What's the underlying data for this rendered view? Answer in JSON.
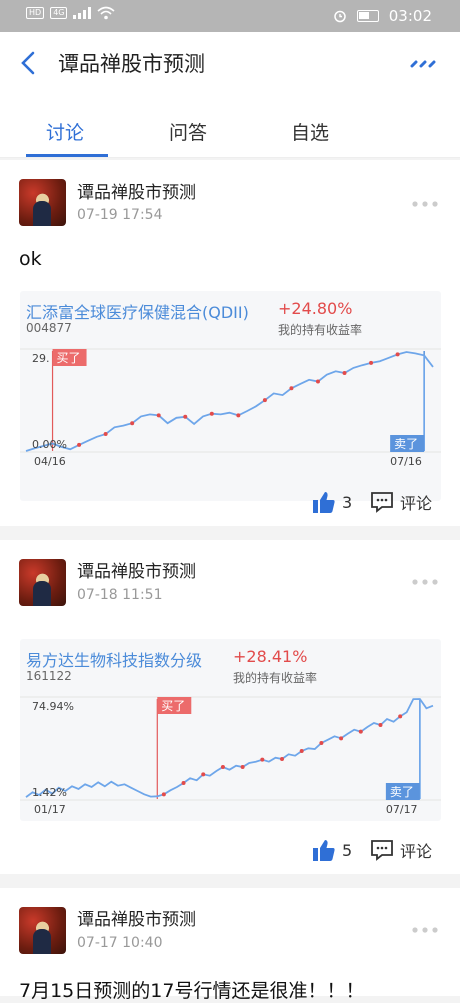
{
  "status_bar": {
    "time": "03:02",
    "signal_left": "HD",
    "signal_right": "4G"
  },
  "header": {
    "title": "谭品禅股市预测"
  },
  "tabs": [
    {
      "label": "讨论",
      "active": true
    },
    {
      "label": "问答"
    },
    {
      "label": "自选"
    }
  ],
  "posts": [
    {
      "author": "谭品禅股市预测",
      "time": "07-19 17:54",
      "text": "ok",
      "fund": {
        "name": "汇添富全球医疗保健混合(QDII)",
        "return": "+24.80%",
        "code": "004877",
        "return_label": "我的持有收益率",
        "y_top": "29.",
        "y_bottom": "0.00%",
        "buy_label": "买了",
        "sell_label": "卖了",
        "x_start": "04/16",
        "x_end": "07/16",
        "chart_data": {
          "type": "line",
          "x": [
            "04/16",
            "07/16"
          ],
          "values": [
            0.0,
            0.8,
            1.5,
            2.2,
            1.2,
            0.5,
            1.8,
            3.0,
            4.2,
            5.0,
            7.0,
            7.5,
            8.2,
            10.2,
            10.8,
            10.5,
            8.2,
            9.8,
            10.1,
            8.0,
            10.2,
            11.0,
            10.8,
            11.3,
            10.5,
            11.8,
            13.2,
            15.0,
            17.0,
            16.5,
            18.5,
            19.8,
            21.0,
            20.5,
            22.5,
            23.5,
            23.0,
            24.5,
            25.3,
            26.0,
            26.5,
            27.5,
            28.5,
            29.2,
            28.8,
            28.2,
            24.8
          ],
          "buy_index": 3,
          "sell_index": 45,
          "ylim": [
            0,
            29.5
          ]
        }
      },
      "likes": "3",
      "comment_label": "评论"
    },
    {
      "author": "谭品禅股市预测",
      "time": "07-18 11:51",
      "fund": {
        "name": "易方达生物科技指数分级",
        "return": "+28.41%",
        "code": "161122",
        "return_label": "我的持有收益率",
        "y_top": "74.94%",
        "y_bottom": "1.42%",
        "buy_label": "买了",
        "sell_label": "卖了",
        "x_start": "01/17",
        "x_end": "07/17",
        "chart_data": {
          "type": "line",
          "x": [
            "01/17",
            "07/17"
          ],
          "values": [
            1.4,
            5.0,
            3.0,
            7.0,
            4.0,
            8.5,
            6.0,
            9.5,
            7.5,
            11.0,
            9.0,
            12.5,
            9.5,
            13.0,
            10.0,
            11.0,
            8.5,
            6.0,
            3.5,
            1.8,
            2.0,
            3.5,
            6.5,
            9.0,
            12.0,
            15.5,
            14.0,
            18.5,
            17.5,
            21.0,
            24.0,
            22.0,
            25.0,
            24.0,
            27.0,
            28.0,
            29.5,
            28.0,
            31.0,
            30.0,
            33.5,
            32.5,
            36.0,
            38.0,
            37.5,
            42.0,
            44.5,
            47.0,
            45.5,
            49.0,
            52.0,
            50.5,
            54.0,
            57.0,
            55.5,
            60.0,
            58.0,
            62.0,
            65.0,
            74.9,
            75.0,
            68.0,
            70.0
          ],
          "buy_index": 20,
          "sell_index": 60,
          "ylim": [
            0,
            75
          ]
        }
      },
      "likes": "5",
      "comment_label": "评论"
    },
    {
      "author": "谭品禅股市预测",
      "time": "07-17 10:40",
      "text": "7月15日预测的17号行情还是很准！！！"
    }
  ]
}
